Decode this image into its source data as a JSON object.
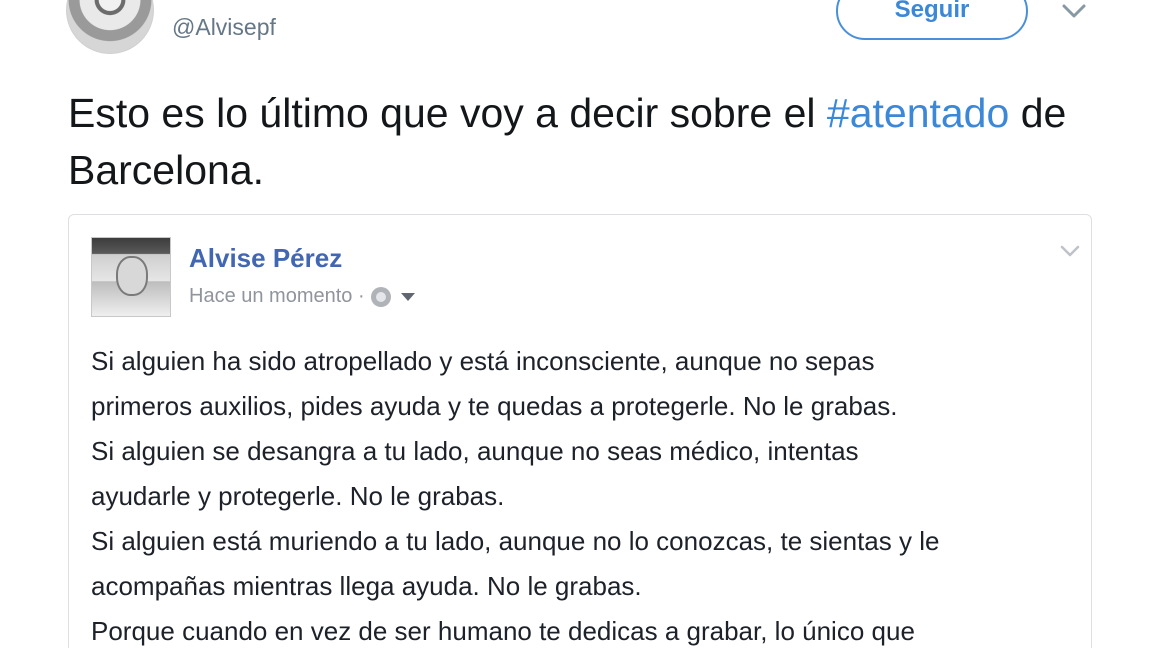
{
  "header": {
    "handle": "@Alvisepf",
    "follow_label": "Seguir"
  },
  "tweet": {
    "text_before": "Esto es lo último que voy a decir sobre el ",
    "hashtag": "#atentado",
    "text_after": " de Barcelona."
  },
  "fb_post": {
    "author": "Alvise Pérez",
    "timestamp": "Hace un momento · ",
    "paragraphs": [
      "Si alguien ha sido atropellado y está inconsciente, aunque no sepas\nprimeros auxilios, pides ayuda y te quedas a protegerle. No le grabas.",
      "Si alguien se desangra a tu lado, aunque no seas médico, intentas\nayudarle y protegerle. No le grabas.",
      "Si alguien está muriendo a tu lado, aunque no lo conozcas, te sientas y le\nacompañas mientras llega ayuda. No le grabas.",
      "Porque cuando en vez de ser humano te dedicas a grabar, lo único que"
    ]
  },
  "colors": {
    "link": "#3b88d8",
    "fb_name": "#4267b2",
    "muted": "#657786"
  },
  "icons": [
    "avatar",
    "caret-down-icon",
    "globe-icon",
    "privacy-dropdown-icon",
    "chevron-down-icon"
  ]
}
